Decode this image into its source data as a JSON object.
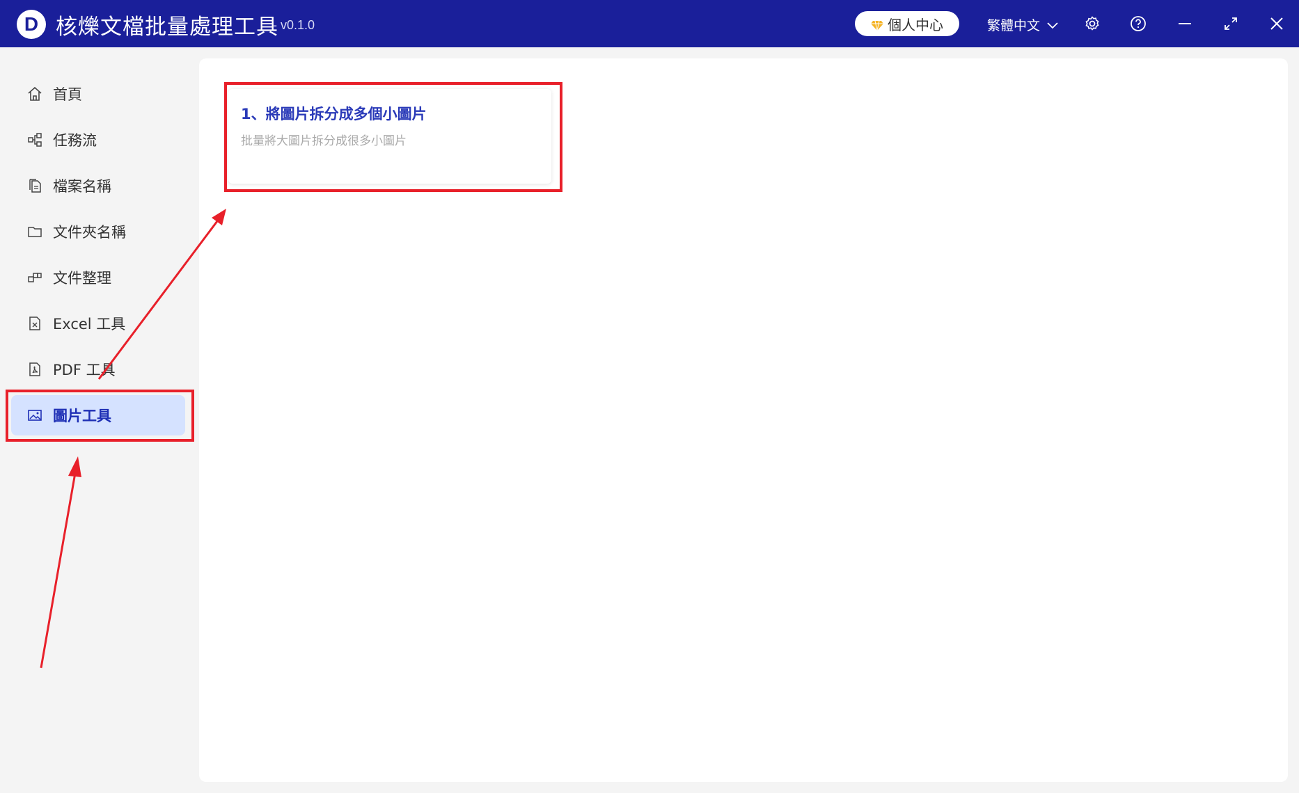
{
  "window": {
    "logo_letter": "D",
    "title": "核爍文檔批量處理工具",
    "version": "- v0.1.0",
    "personal_center": "個人中心",
    "language": "繁體中文"
  },
  "sidebar": {
    "items": [
      {
        "label": "首頁",
        "icon": "home-icon"
      },
      {
        "label": "任務流",
        "icon": "workflow-icon"
      },
      {
        "label": "檔案名稱",
        "icon": "file-copy-icon"
      },
      {
        "label": "文件夾名稱",
        "icon": "folder-icon"
      },
      {
        "label": "文件整理",
        "icon": "organize-icon"
      },
      {
        "label": "Excel 工具",
        "icon": "excel-file-icon"
      },
      {
        "label": "PDF 工具",
        "icon": "pdf-file-icon"
      },
      {
        "label": "圖片工具",
        "icon": "image-icon",
        "active": true
      }
    ]
  },
  "main": {
    "cards": [
      {
        "title": "1、將圖片拆分成多個小圖片",
        "description": "批量將大圖片拆分成很多小圖片"
      }
    ]
  },
  "colors": {
    "titlebar": "#1a1f9a",
    "accent": "#1e2fb5",
    "active_bg": "#d5e2ff",
    "annotation": "#e8202a"
  }
}
